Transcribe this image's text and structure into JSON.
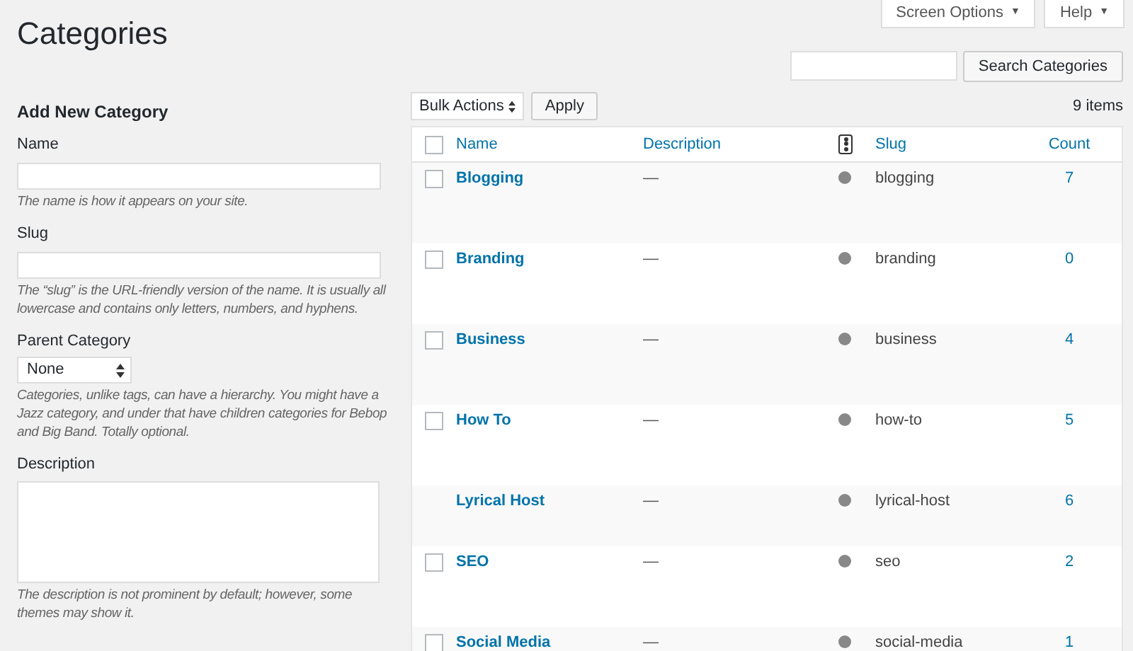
{
  "page_title": "Categories",
  "header_buttons": [
    {
      "label": "Screen Options",
      "caret": "▼"
    },
    {
      "label": "Help",
      "caret": "▼"
    }
  ],
  "search": {
    "button": "Search Categories"
  },
  "form": {
    "heading": "Add New Category",
    "fields": [
      {
        "kind": "text",
        "label": "Name",
        "help": "The name is how it appears on your site."
      },
      {
        "kind": "text",
        "label": "Slug",
        "help": "The “slug” is the URL-friendly version of the name. It is usually all lowercase and contains only letters, numbers, and hyphens."
      },
      {
        "kind": "select",
        "label": "Parent Category",
        "value": "None",
        "help": "Categories, unlike tags, can have a hierarchy. You might have a Jazz category, and under that have children categories for Bebop and Big Band. Totally optional."
      },
      {
        "kind": "textarea",
        "label": "Description",
        "help": "The description is not prominent by default; however, some themes may show it."
      }
    ]
  },
  "bulk": {
    "select": "Bulk Actions",
    "apply": "Apply",
    "count": "9 items"
  },
  "table": {
    "columns": [
      "Name",
      "Description",
      "Slug",
      "Count"
    ],
    "header_checked": false,
    "rows": [
      {
        "kind": "normal",
        "checked": false,
        "name": "Blogging",
        "description": "—",
        "slug": "blogging",
        "count": "7"
      },
      {
        "kind": "normal",
        "checked": false,
        "name": "Branding",
        "description": "—",
        "slug": "branding",
        "count": "0"
      },
      {
        "kind": "normal",
        "checked": false,
        "name": "Business",
        "description": "—",
        "slug": "business",
        "count": "4"
      },
      {
        "kind": "normal",
        "checked": false,
        "name": "How To",
        "description": "—",
        "slug": "how-to",
        "count": "5"
      },
      {
        "kind": "default",
        "name": "Lyrical Host",
        "description": "—",
        "slug": "lyrical-host",
        "count": "6"
      },
      {
        "kind": "normal",
        "checked": false,
        "name": "SEO",
        "description": "—",
        "slug": "seo",
        "count": "2"
      },
      {
        "kind": "normal",
        "checked": false,
        "name": "Social Media",
        "description": "—",
        "slug": "social-media",
        "count": "1"
      }
    ]
  }
}
